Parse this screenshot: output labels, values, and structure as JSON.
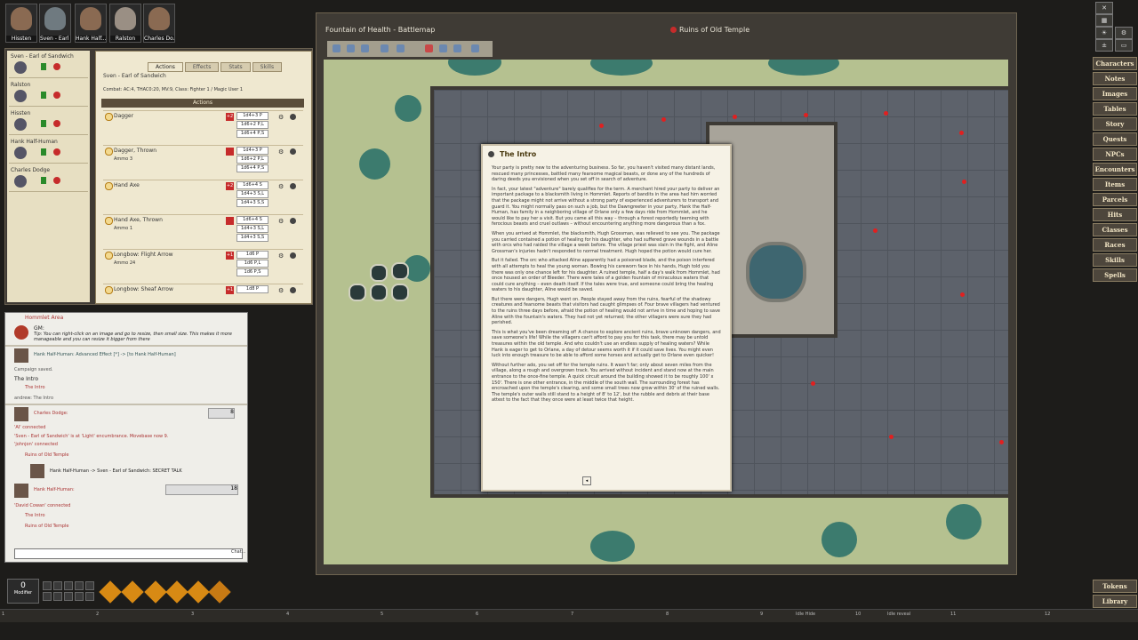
{
  "party": [
    {
      "name": "Hissten"
    },
    {
      "name": "Sven - Earl ..."
    },
    {
      "name": "Hank Half..."
    },
    {
      "name": "Ralston"
    },
    {
      "name": "Charles Do..."
    }
  ],
  "combat_tracker": [
    {
      "name": "Sven - Earl of Sandwich"
    },
    {
      "name": "Ralston"
    },
    {
      "name": "Hissten"
    },
    {
      "name": "Hank Half-Human"
    },
    {
      "name": "Charles Dodge"
    }
  ],
  "actions_panel": {
    "tabs": [
      "Actions",
      "Effects",
      "Stats",
      "Skills"
    ],
    "character": "Sven - Earl of Sandwich",
    "combat_line": "Combat: AC:4, THAC0:20, MV:9, Class: Fighter 1 / Magic User 1",
    "header": "Actions",
    "weapons": [
      {
        "name": "Dagger",
        "bonus": "+2",
        "dice": [
          "1d4+3 P",
          "1d6+2 P,L",
          "1d6+4 P,S"
        ]
      },
      {
        "name": "Dagger, Thrown",
        "ammo_label": "Ammo",
        "ammo": "3",
        "bonus": "",
        "dice": [
          "1d4+3 P",
          "1d6+2 P,L",
          "1d6+4 P,S"
        ]
      },
      {
        "name": "Hand Axe",
        "bonus": "+2",
        "dice": [
          "1d6+4 S",
          "1d4+3 S,L",
          "1d4+3 S,S"
        ]
      },
      {
        "name": "Hand Axe, Thrown",
        "ammo_label": "Ammo",
        "ammo": "1",
        "bonus": "",
        "dice": [
          "1d6+4 S",
          "1d4+3 S,L",
          "1d4+3 S,S"
        ]
      },
      {
        "name": "Longbow: Flight Arrow",
        "ammo_label": "Ammo",
        "ammo": "24",
        "bonus": "+1",
        "dice": [
          "1d6 P",
          "1d6 P,L",
          "1d6 P,S"
        ]
      },
      {
        "name": "Longbow: Sheaf Arrow",
        "bonus": "+1",
        "dice": [
          "1d8 P"
        ]
      }
    ]
  },
  "chat": {
    "first": "Hommlet Area",
    "gm_name": "GM:",
    "tip": "Tip: You can right-click on an image and go to resize, then small size. This makes it more manageable and you can resize it bigger from there",
    "effect_line": "Hank Half-Human: Advanced Effect [*] -> [to Hank Half-Human]",
    "campaign_saved": "Campaign saved.",
    "the_intro": "The Intro",
    "the_intro2": "The Intro",
    "andrew": "andrew: The Intro",
    "charles": "Charles Dodge:",
    "sven_enc": "'Sven - Earl of Sandwich' is at 'Light' encumbrance. Movebase now 9.",
    "johnjon": "'johnjon' connected",
    "ai": "'AI' connected",
    "ruins": "Ruins of Old Temple",
    "secret_talk": "Hank Half-Human -> Sven - Earl of Sandwich: SECRET TALK",
    "hank": "Hank Half-Human:",
    "david": "'David Cowan' connected",
    "the_intro3": "The Intro",
    "ruins2": "Ruins of Old Temple",
    "roll1": "8",
    "roll2": "18",
    "send": "Chat..."
  },
  "modifier": {
    "value": "0",
    "label": "Modifier"
  },
  "map": {
    "title": "Fountain of Health - Battlemap",
    "scene": "Ruins of Old Temple"
  },
  "story": {
    "title": "The Intro",
    "paragraphs": [
      "Your party is pretty new to the adventuring business. So far, you haven't visited many distant lands, rescued many princesses, battled many fearsome magical beasts, or done any of the hundreds of daring deeds you envisioned when you set off in search of adventure.",
      "In fact, your latest \"adventure\" barely qualifies for the term. A merchant hired your party to deliver an important package to a blacksmith living in Hommlet. Reports of bandits in the area had him worried that the package might not arrive without a strong party of experienced adventurers to transport and guard it. You might normally pass on such a job, but the Dawngreeter in your party, Hank the Half-Human, has family in a neighboring village of Orlane only a few days ride from Hommlet, and he would like to pay her a visit. But you came all this way – through a forest reportedly teeming with ferocious beasts and cruel outlaws – without encountering anything more dangerous than a fox.",
      "When you arrived at Hommlet, the blacksmith, Hugh Grossman, was relieved to see you. The package you carried contained a potion of healing for his daughter, who had suffered grave wounds in a battle with orcs who had raided the village a week before. The village priest was slain in the fight, and Aline Grossman's injuries hadn't responded to normal treatment. Hugh hoped the potion would cure her.",
      "But it failed. The orc who attacked Aline apparently had a poisoned blade, and the poison interfered with all attempts to heal the young woman. Bowing his careworn face in his hands, Hugh told you there was only one chance left for his daughter. A ruined temple, half a day's walk from Hommlet, had once housed an order of Bleeder. There were tales of a golden fountain of miraculous waters that could cure anything – even death itself. If the tales were true, and someone could bring the healing waters to his daughter, Aline would be saved.",
      "But there were dangers, Hugh went on. People stayed away from the ruins, fearful of the shadowy creatures and fearsome beasts that visitors had caught glimpses of. Four brave villagers had ventured to the ruins three days before, afraid the potion of healing would not arrive in time and hoping to save Aline with the fountain's waters. They had not yet returned; the other villagers were sure they had perished.",
      "This is what you've been dreaming of! A chance to explore ancient ruins, brave unknown dangers, and save someone's life! While the villagers can't afford to pay you for this task, there may be untold treasures within the old temple. And who couldn't use an endless supply of healing waters? While Hank is eager to get to Orlane, a day of detour seems worth it if it could save lives. You might even luck into enough treasure to be able to afford some horses and actually get to Orlane even quicker!",
      "Without further ado, you set off for the temple ruins. It wasn't far; only about seven miles from the village, along a rough and overgrown track. You arrived without incident and stand now at the main entrance to the once-fine temple. A quick circuit around the building showed it to be roughly 100' x 150'. There is one other entrance, in the middle of the south wall. The surrounding forest has encroached upon the temple's clearing, and some small trees now grow within 30' of the ruined walls. The temple's outer walls still stand to a height of 8' to 12', but the rubble and debris at their base attest to the fact that they once were at least twice that height."
    ]
  },
  "sidebar": [
    "Characters",
    "Notes",
    "Images",
    "Tables",
    "Story",
    "Quests",
    "NPCs",
    "Encounters",
    "Items",
    "Parcels",
    "Hits",
    "Classes",
    "Races",
    "Skills",
    "Spells"
  ],
  "sidebar_bottom": [
    "Tokens",
    "Library"
  ],
  "ruler": [
    "1",
    "2",
    "3",
    "4",
    "5",
    "6",
    "7",
    "8",
    "9",
    "10",
    "11",
    "12"
  ],
  "ruler_text": [
    "Idle Hide",
    "Idle reveal"
  ]
}
